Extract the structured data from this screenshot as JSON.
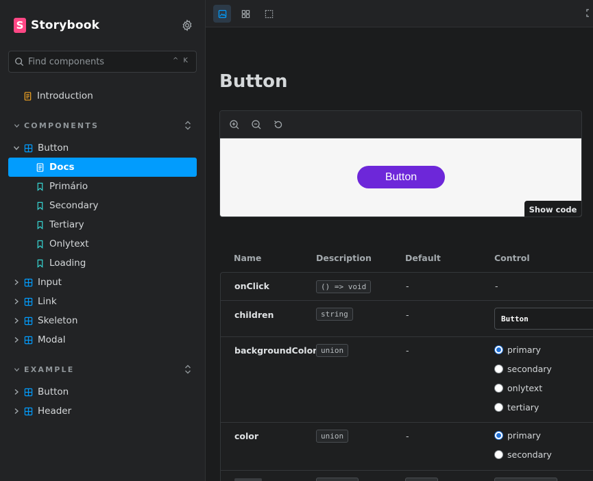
{
  "app": {
    "name": "Storybook",
    "logo_letter": "S"
  },
  "search": {
    "placeholder": "Find components",
    "shortcut": "^ K"
  },
  "sidebar": {
    "introduction": "Introduction",
    "sections": [
      {
        "label": "COMPONENTS"
      },
      {
        "label": "EXAMPLE"
      }
    ],
    "components": {
      "button": "Button",
      "stories": [
        "Docs",
        "Primário",
        "Secondary",
        "Tertiary",
        "Onlytext",
        "Loading"
      ],
      "others": [
        "Input",
        "Link",
        "Skeleton",
        "Modal"
      ]
    },
    "example": [
      "Button",
      "Header"
    ]
  },
  "main": {
    "title": "Button",
    "preview_button_label": "Button",
    "show_code_label": "Show code",
    "table": {
      "headers": [
        "Name",
        "Description",
        "Default",
        "Control"
      ],
      "rows": [
        {
          "name": "onClick",
          "type": "() => void",
          "default": "-",
          "control": "-"
        },
        {
          "name": "children",
          "type": "string",
          "default": "-",
          "control_value": "Button"
        },
        {
          "name": "backgroundColor",
          "type": "union",
          "default": "-",
          "options": [
            "primary",
            "secondary",
            "onlytext",
            "tertiary"
          ],
          "selected": "primary"
        },
        {
          "name": "color",
          "type": "union",
          "default": "-",
          "options": [
            "primary",
            "secondary"
          ],
          "selected": "primary"
        }
      ]
    }
  },
  "colors": {
    "accent": "#029cfd",
    "brand": "#ff4785",
    "button": "#6d27d9"
  }
}
